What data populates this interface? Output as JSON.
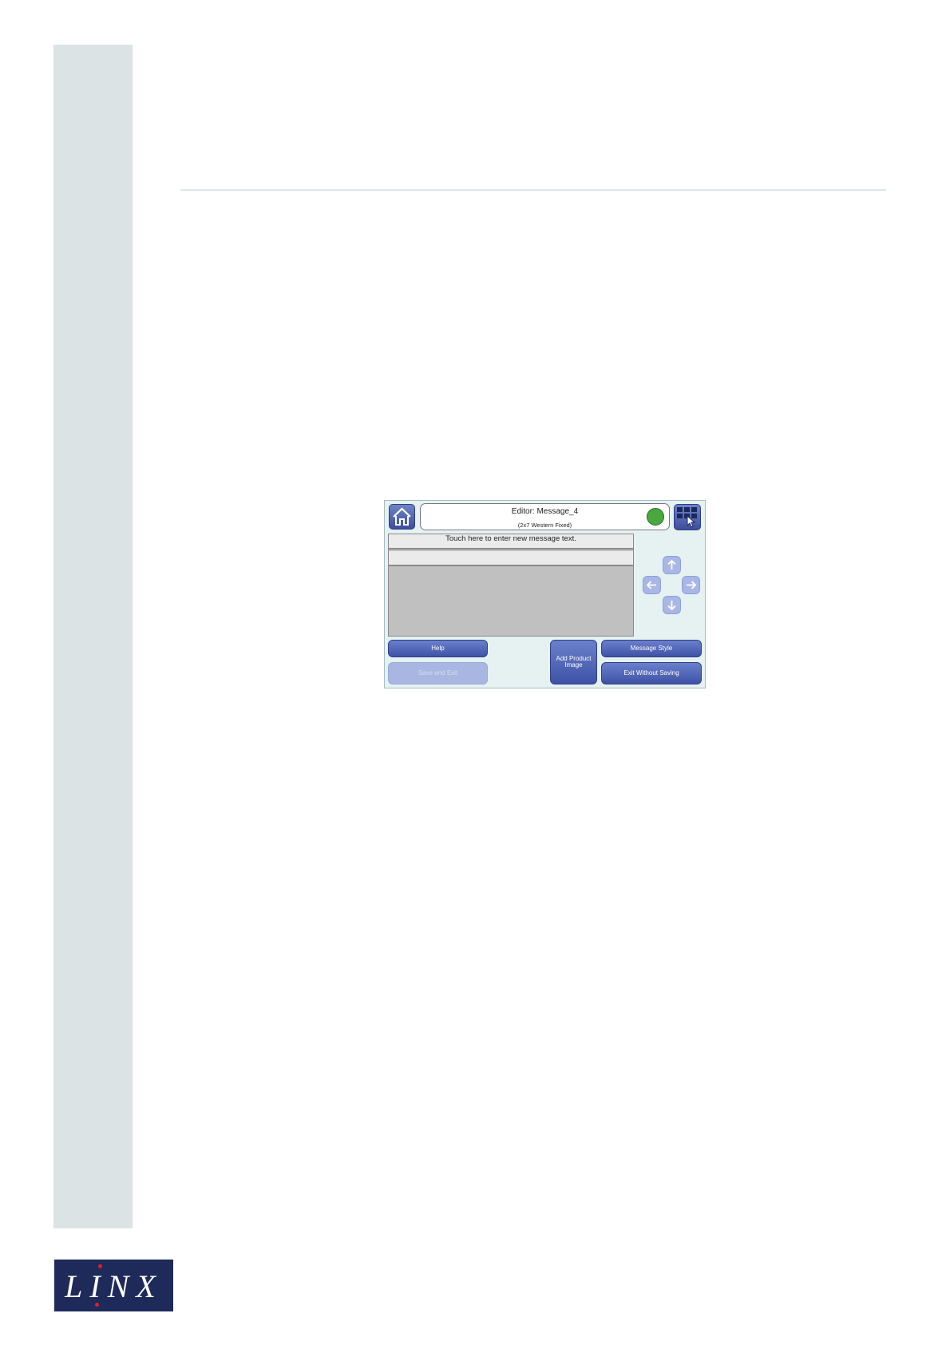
{
  "screen": {
    "title": "Editor: Message_4",
    "subtitle": "(2x7 Western Fixed)",
    "status_color": "#4aa83f",
    "text_hint": "Touch here to enter new message text.",
    "icons": {
      "home": "home-icon",
      "menu": "grid-menu-icon",
      "up": "arrow-up-icon",
      "left": "arrow-left-icon",
      "right": "arrow-right-icon",
      "down": "arrow-down-icon"
    },
    "buttons": {
      "help": "Help",
      "save_exit": "Save and Exit",
      "add_image_line1": "Add Product",
      "add_image_line2": "Image",
      "message_style": "Message Style",
      "exit_without_saving": "Exit Without Saving"
    }
  },
  "logo": {
    "text": "LINX"
  }
}
